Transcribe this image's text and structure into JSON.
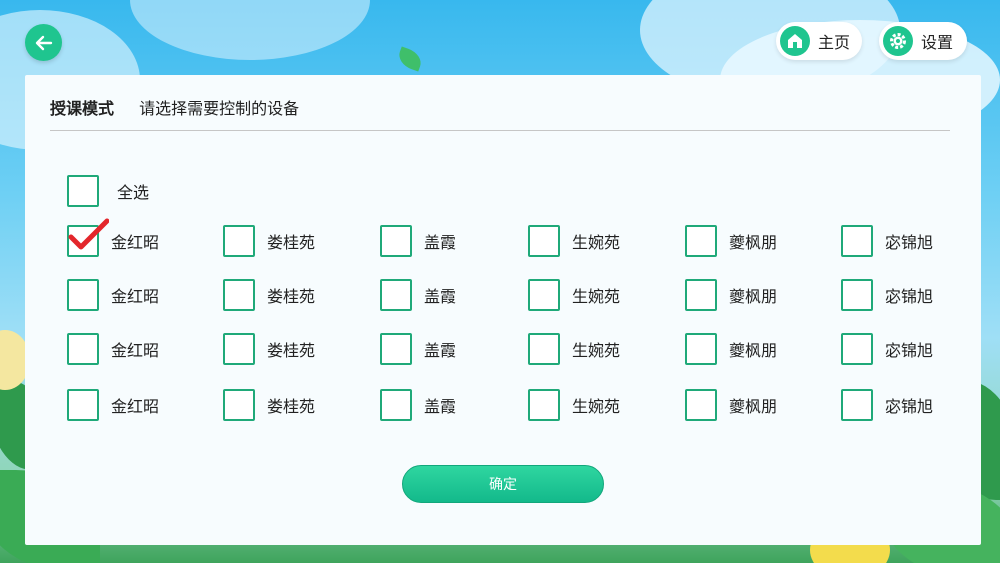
{
  "nav": {
    "home_label": "主页",
    "settings_label": "设置"
  },
  "header": {
    "mode": "授课模式",
    "prompt": "请选择需要控制的设备"
  },
  "select_all": {
    "label": "全选",
    "checked": false
  },
  "devices": [
    [
      {
        "label": "金红昭",
        "checked": true
      },
      {
        "label": "娄桂苑",
        "checked": false
      },
      {
        "label": "盖霞",
        "checked": false
      },
      {
        "label": "生婉苑",
        "checked": false
      },
      {
        "label": "夔枫朋",
        "checked": false
      },
      {
        "label": "宓锦旭",
        "checked": false
      }
    ],
    [
      {
        "label": "金红昭",
        "checked": false
      },
      {
        "label": "娄桂苑",
        "checked": false
      },
      {
        "label": "盖霞",
        "checked": false
      },
      {
        "label": "生婉苑",
        "checked": false
      },
      {
        "label": "夔枫朋",
        "checked": false
      },
      {
        "label": "宓锦旭",
        "checked": false
      }
    ],
    [
      {
        "label": "金红昭",
        "checked": false
      },
      {
        "label": "娄桂苑",
        "checked": false
      },
      {
        "label": "盖霞",
        "checked": false
      },
      {
        "label": "生婉苑",
        "checked": false
      },
      {
        "label": "夔枫朋",
        "checked": false
      },
      {
        "label": "宓锦旭",
        "checked": false
      }
    ],
    [
      {
        "label": "金红昭",
        "checked": false
      },
      {
        "label": "娄桂苑",
        "checked": false
      },
      {
        "label": "盖霞",
        "checked": false
      },
      {
        "label": "生婉苑",
        "checked": false
      },
      {
        "label": "夔枫朋",
        "checked": false
      },
      {
        "label": "宓锦旭",
        "checked": false
      }
    ]
  ],
  "confirm_label": "确定",
  "colors": {
    "accent": "#1fc58f",
    "checkbox_border": "#1fa979",
    "check_mark": "#e3262b"
  }
}
